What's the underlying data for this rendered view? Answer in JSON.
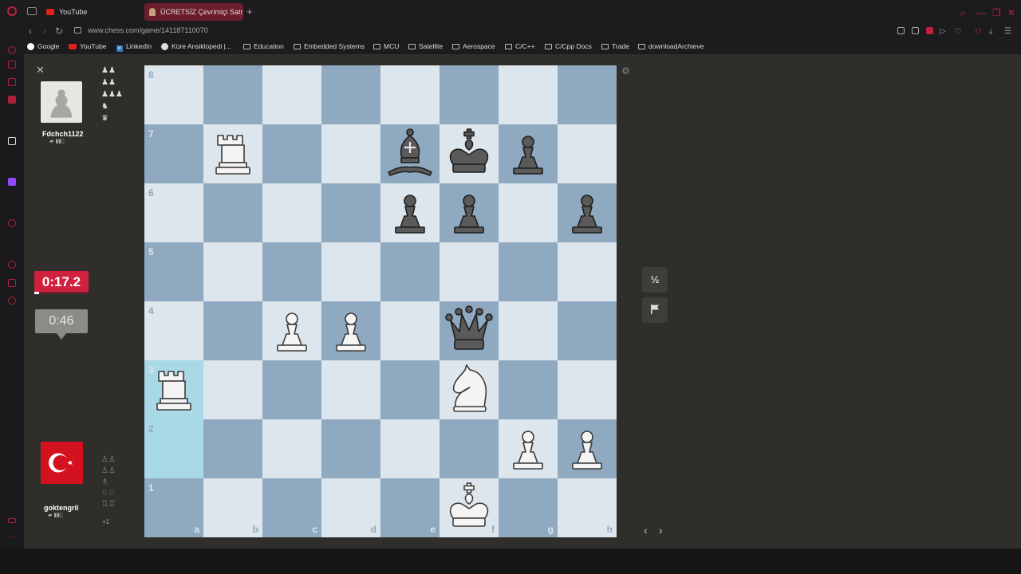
{
  "browser": {
    "tabs": [
      {
        "label": "YouTube"
      },
      {
        "label": "ÜCRETSİZ Çevrimiçi Satranç"
      }
    ],
    "url": "www.chess.com/game/141187110070",
    "bookmarks": [
      "Google",
      "YouTube",
      "LinkedIn",
      "Küre Ansiklopedi |...",
      "Education",
      "Embedded Systems",
      "MCU",
      "Satellite",
      "Aerospace",
      "C/C++",
      "C/Cpp Docs",
      "Trade",
      "downloadArchieve"
    ],
    "accent_color": "#c0203a"
  },
  "top_player": {
    "name": "Fdchch1122",
    "clock": "0:46",
    "captured": [
      "♟♟",
      "♟♟",
      "♟♟♟",
      "♞",
      "♛"
    ]
  },
  "bottom_player": {
    "name": "goktengrii",
    "clock": "0:17.2",
    "captured": [
      "♙♙",
      "♙♙",
      "♗",
      "♘♘",
      "♖♖"
    ],
    "material_advantage": "+1"
  },
  "board": {
    "ranks": [
      "8",
      "7",
      "6",
      "5",
      "4",
      "3",
      "2",
      "1"
    ],
    "files": [
      "a",
      "b",
      "c",
      "d",
      "e",
      "f",
      "g",
      "h"
    ],
    "light_color": "#dde6ec",
    "dark_color": "#8fa9c0",
    "highlight_squares": [
      "a3",
      "a2"
    ],
    "pieces": [
      {
        "square": "b7",
        "piece": "wR"
      },
      {
        "square": "e7",
        "piece": "bB"
      },
      {
        "square": "f7",
        "piece": "bK"
      },
      {
        "square": "g7",
        "piece": "bP"
      },
      {
        "square": "e6",
        "piece": "bP"
      },
      {
        "square": "f6",
        "piece": "bP"
      },
      {
        "square": "h6",
        "piece": "bP"
      },
      {
        "square": "c4",
        "piece": "wP"
      },
      {
        "square": "d4",
        "piece": "wP"
      },
      {
        "square": "f4",
        "piece": "bQ"
      },
      {
        "square": "a3",
        "piece": "wR"
      },
      {
        "square": "f3",
        "piece": "wN"
      },
      {
        "square": "g2",
        "piece": "wP"
      },
      {
        "square": "h2",
        "piece": "wP"
      },
      {
        "square": "f1",
        "piece": "wK"
      }
    ]
  },
  "controls": {
    "draw_label": "½",
    "resign_icon": "flag-icon"
  }
}
